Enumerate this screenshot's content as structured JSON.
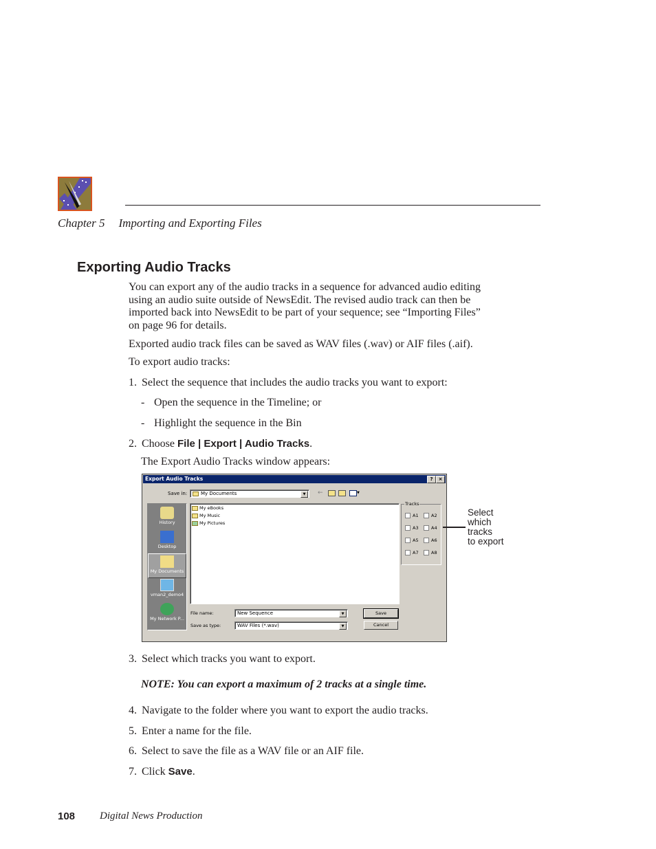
{
  "header": {
    "logo_icon": "film-reel-scissors-logo-icon",
    "chapter_label": "Chapter 5",
    "chapter_title": "Importing and Exporting Files"
  },
  "section": {
    "title": "Exporting Audio Tracks",
    "intro_lines": [
      "You can export any of the audio tracks in a sequence for advanced audio editing",
      "using an audio suite outside of NewsEdit. The revised audio track can then be",
      "imported back into NewsEdit to be part of your sequence; see “Importing Files”",
      "on page 96 for details."
    ],
    "formats_paragraph": "Exported audio track files can be saved as WAV files (.wav) or AIF files (.aif).",
    "lead_in": "To export audio tracks:"
  },
  "steps": [
    {
      "num": "1.",
      "text": "Select the sequence that includes the audio tracks you want to export:"
    },
    {
      "num": "2.",
      "prefix": "Choose ",
      "bold": "File | Export | Audio Tracks",
      "suffix": "."
    },
    {
      "num": "3.",
      "text": "Select which tracks you want to export."
    },
    {
      "num": "4.",
      "text": "Navigate to the folder where you want to export the audio tracks."
    },
    {
      "num": "5.",
      "text": "Enter a name for the file."
    },
    {
      "num": "6.",
      "text": "Select to save the file as a WAV file or an AIF file."
    },
    {
      "num": "7.",
      "prefix": "Click ",
      "bold": "Save",
      "suffix": "."
    }
  ],
  "substeps": [
    {
      "dash": "-",
      "text": "Open the sequence in the Timeline; or"
    },
    {
      "dash": "-",
      "text": "Highlight the sequence in the Bin"
    }
  ],
  "step2_result": "The Export Audio Tracks window appears:",
  "note": "NOTE: You can export a maximum of 2 tracks at a single time.",
  "dialog": {
    "title": "Export Audio Tracks",
    "help_button": "?",
    "close_button": "×",
    "save_in_label": "Save in:",
    "save_in_value": "My Documents",
    "places": [
      {
        "label": "History",
        "icon": "history-icon"
      },
      {
        "label": "Desktop",
        "icon": "desktop-icon"
      },
      {
        "label": "My Documents",
        "icon": "my-documents-icon",
        "selected": true
      },
      {
        "label": "vman2_demo4",
        "icon": "computer-icon"
      },
      {
        "label": "My Network P...",
        "icon": "network-places-icon"
      }
    ],
    "files": [
      {
        "name": "My eBooks",
        "icon": "folder-icon"
      },
      {
        "name": "My Music",
        "icon": "folder-icon"
      },
      {
        "name": "My Pictures",
        "icon": "pictures-folder-icon"
      }
    ],
    "tracks_legend": "Tracks",
    "tracks": [
      {
        "label": "A1",
        "checked": false
      },
      {
        "label": "A2",
        "checked": false
      },
      {
        "label": "A3",
        "checked": false
      },
      {
        "label": "A4",
        "checked": false
      },
      {
        "label": "A5",
        "checked": false
      },
      {
        "label": "A6",
        "checked": false
      },
      {
        "label": "A7",
        "checked": false
      },
      {
        "label": "A8",
        "checked": false
      }
    ],
    "file_name_label": "File name:",
    "file_name_value": "New Sequence",
    "save_as_type_label": "Save as type:",
    "save_as_type_value": "WAV Files (*.wav)",
    "save_button": "Save",
    "cancel_button": "Cancel"
  },
  "callout": [
    "Select",
    "which",
    "tracks",
    "to export"
  ],
  "footer": {
    "page_number": "108",
    "book_title": "Digital News Production"
  }
}
